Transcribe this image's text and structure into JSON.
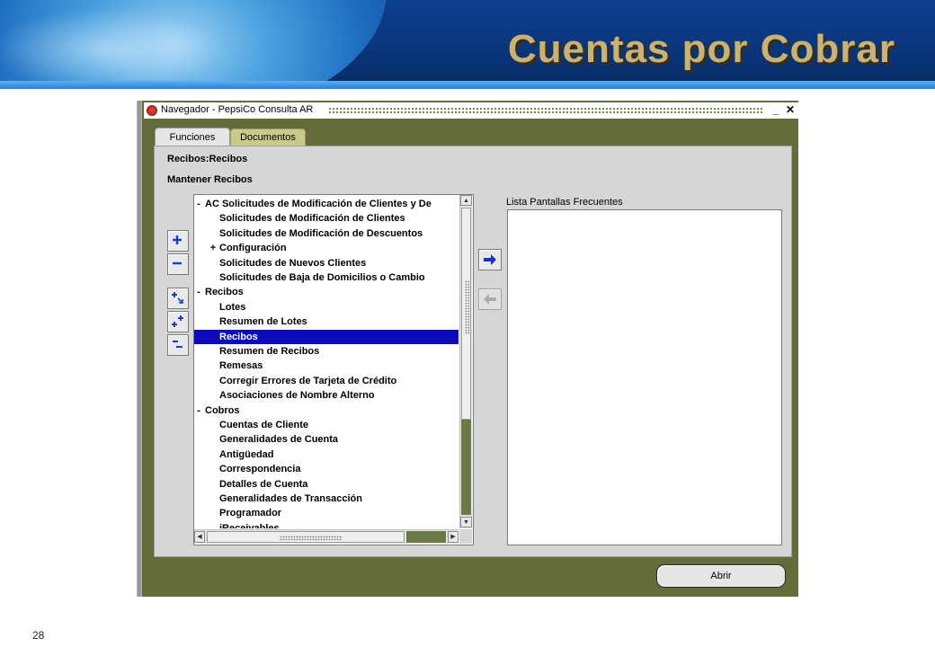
{
  "slide": {
    "title": "Cuentas por Cobrar",
    "page_number": "28"
  },
  "window": {
    "title": "Navegador - PepsiCo Consulta AR",
    "controls": [
      "minimize-icon",
      "close-icon"
    ]
  },
  "tabs": [
    {
      "label": "Funciones",
      "active": true
    },
    {
      "label": "Documentos",
      "active": false
    }
  ],
  "header": {
    "path": "Recibos:Recibos",
    "subtitle": "Mantener Recibos"
  },
  "side_buttons": [
    "expand-icon",
    "collapse-icon",
    "expand-branch-icon",
    "expand-all-icon",
    "collapse-all-icon"
  ],
  "tree": {
    "items": [
      {
        "marker": "-",
        "label": "AC Solicitudes de Modificación de Clientes y De",
        "level": 0,
        "selected": false
      },
      {
        "marker": "",
        "label": "Solicitudes de Modificación de Clientes",
        "level": 1,
        "selected": false
      },
      {
        "marker": "",
        "label": "Solicitudes de Modificación de Descuentos",
        "level": 1,
        "selected": false
      },
      {
        "marker": "+",
        "label": "Configuración",
        "level": 1,
        "selected": false
      },
      {
        "marker": "",
        "label": "Solicitudes de Nuevos Clientes",
        "level": 1,
        "selected": false
      },
      {
        "marker": "",
        "label": "Solicitudes de Baja de Domicilios o Cambio",
        "level": 1,
        "selected": false
      },
      {
        "marker": "-",
        "label": "Recibos",
        "level": 0,
        "selected": false
      },
      {
        "marker": "",
        "label": "Lotes",
        "level": 1,
        "selected": false
      },
      {
        "marker": "",
        "label": "Resumen de Lotes",
        "level": 1,
        "selected": false
      },
      {
        "marker": "",
        "label": "Recibos",
        "level": 1,
        "selected": true
      },
      {
        "marker": "",
        "label": "Resumen de Recibos",
        "level": 1,
        "selected": false
      },
      {
        "marker": "",
        "label": "Remesas",
        "level": 1,
        "selected": false
      },
      {
        "marker": "",
        "label": "Corregir Errores de Tarjeta de Crédito",
        "level": 1,
        "selected": false
      },
      {
        "marker": "",
        "label": "Asociaciones de Nombre Alterno",
        "level": 1,
        "selected": false
      },
      {
        "marker": "-",
        "label": "Cobros",
        "level": 0,
        "selected": false
      },
      {
        "marker": "",
        "label": "Cuentas de Cliente",
        "level": 1,
        "selected": false
      },
      {
        "marker": "",
        "label": "Generalidades de Cuenta",
        "level": 1,
        "selected": false
      },
      {
        "marker": "",
        "label": "Antigüedad",
        "level": 1,
        "selected": false
      },
      {
        "marker": "",
        "label": "Correspondencia",
        "level": 1,
        "selected": false
      },
      {
        "marker": "",
        "label": "Detalles de Cuenta",
        "level": 1,
        "selected": false
      },
      {
        "marker": "",
        "label": "Generalidades de Transacción",
        "level": 1,
        "selected": false
      },
      {
        "marker": "",
        "label": "Programador",
        "level": 1,
        "selected": false
      },
      {
        "marker": "",
        "label": "iReceivables",
        "level": 1,
        "selected": false
      }
    ]
  },
  "move_buttons": [
    "arrow-right-icon",
    "arrow-left-icon"
  ],
  "frequent_list": {
    "label": "Lista Pantallas Frecuentes",
    "items": []
  },
  "open_button": {
    "label": "Abrir"
  },
  "colors": {
    "banner": "#0a3478",
    "title_text": "#c8b278",
    "window_bg": "#646b3a",
    "selection": "#0a0ab8",
    "panel": "#d6d6d6"
  }
}
